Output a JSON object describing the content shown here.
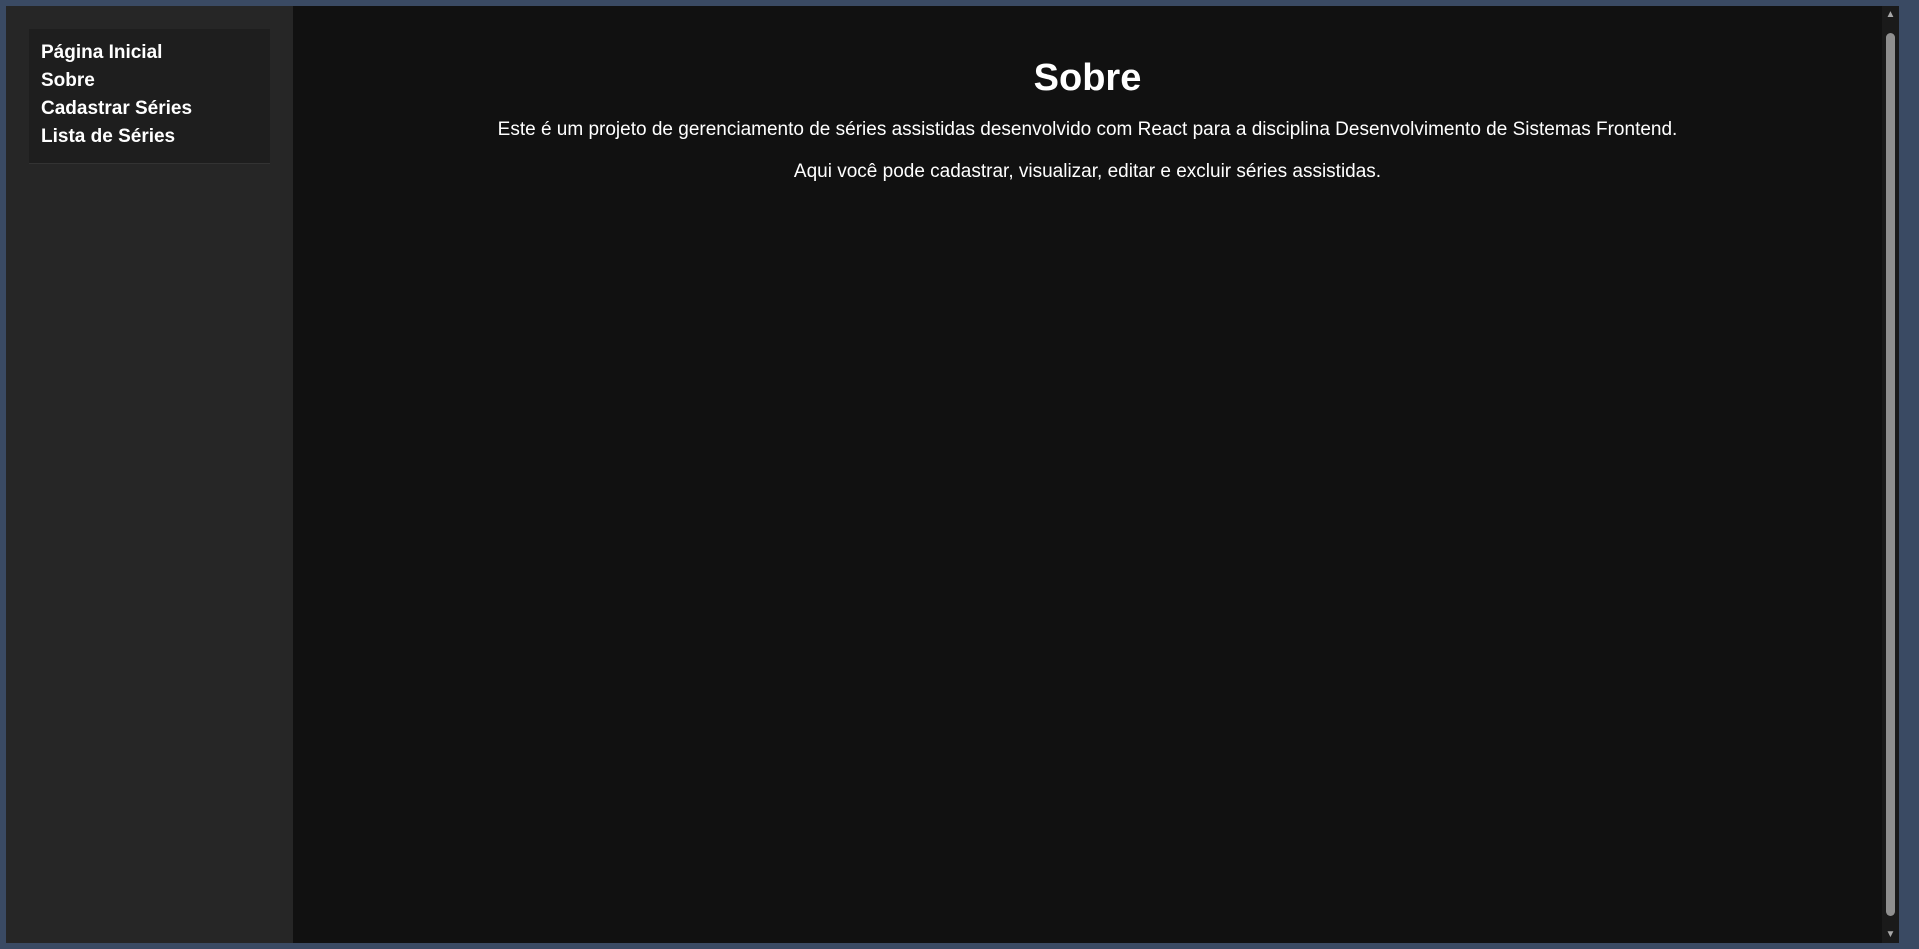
{
  "sidebar": {
    "items": [
      {
        "label": "Página Inicial"
      },
      {
        "label": "Sobre"
      },
      {
        "label": "Cadastrar Séries"
      },
      {
        "label": "Lista de Séries"
      }
    ]
  },
  "main": {
    "title": "Sobre",
    "paragraphs": [
      "Este é um projeto de gerenciamento de séries assistidas desenvolvido com React para a disciplina Desenvolvimento de Sistemas Frontend.",
      "Aqui você pode cadastrar, visualizar, editar e excluir séries assistidas."
    ]
  },
  "icons": {
    "scroll_up": "triangle-up",
    "scroll_down": "triangle-down"
  }
}
